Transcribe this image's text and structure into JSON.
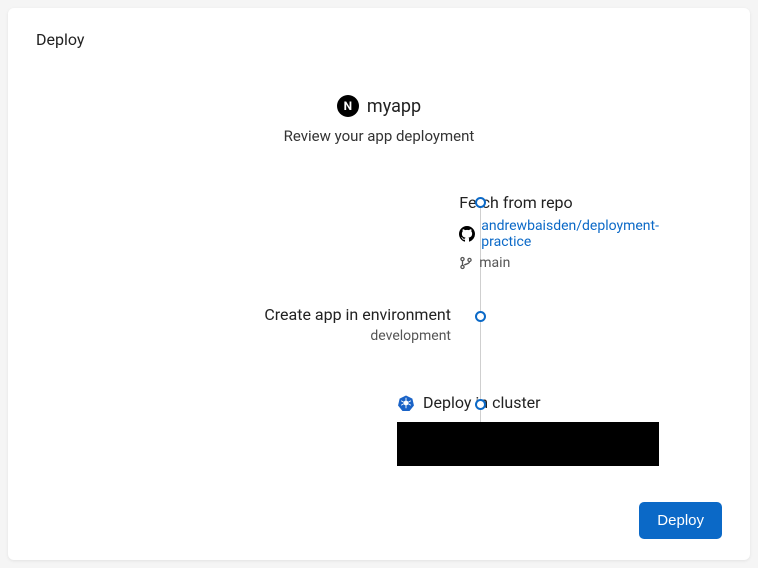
{
  "header": {
    "title": "Deploy"
  },
  "app": {
    "icon_letter": "N",
    "name": "myapp",
    "subtitle": "Review your app deployment"
  },
  "steps": {
    "fetch": {
      "title": "Fetch from repo",
      "repo": "andrewbaisden/deployment-practice",
      "branch": "main"
    },
    "create": {
      "title": "Create app in environment",
      "env": "development"
    },
    "deploy": {
      "title": "Deploy in cluster"
    }
  },
  "footer": {
    "deploy_label": "Deploy"
  }
}
